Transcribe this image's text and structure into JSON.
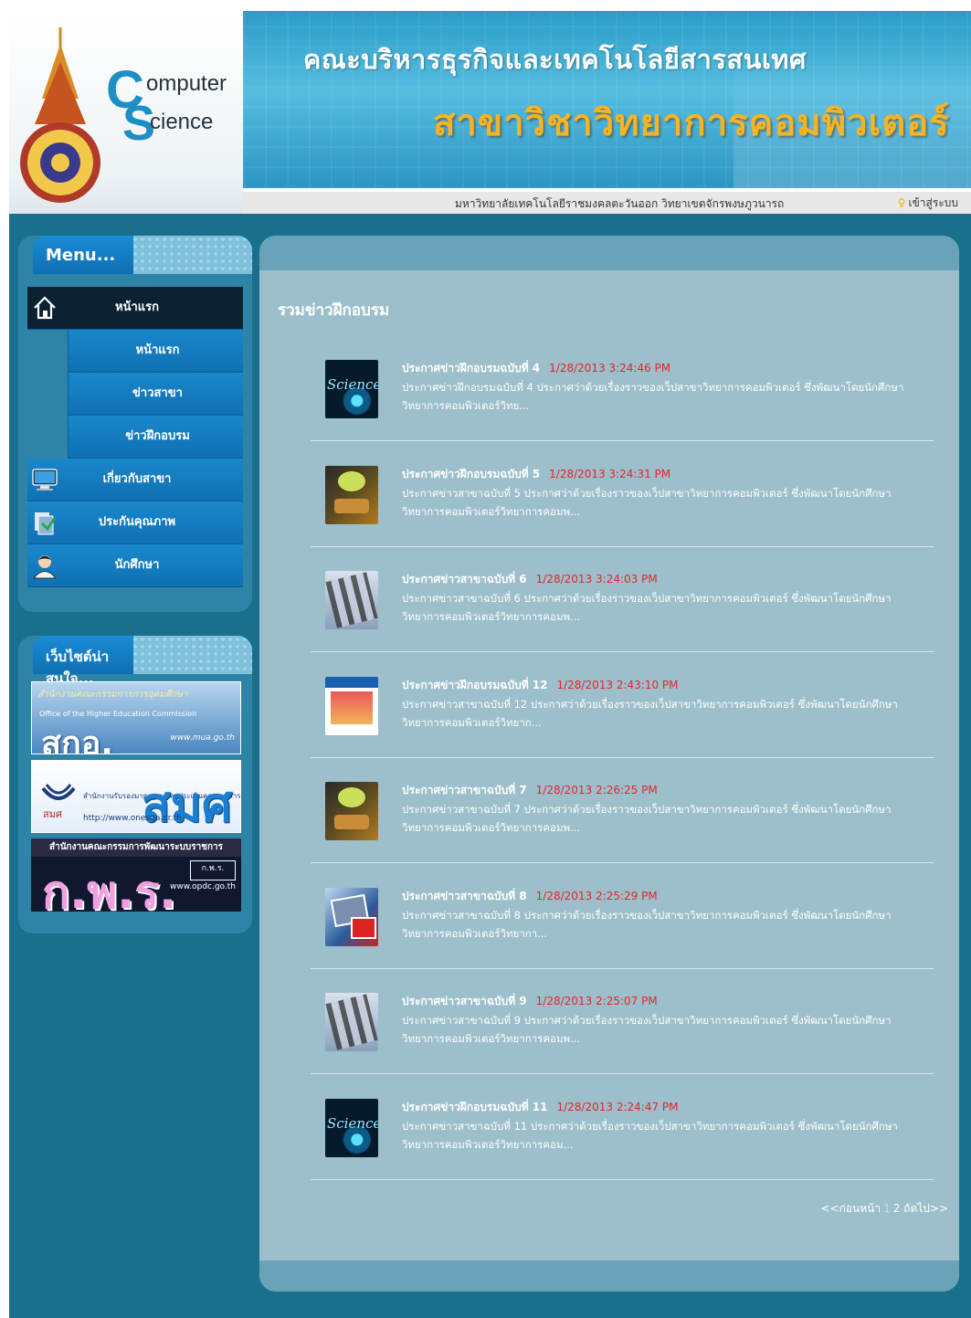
{
  "header": {
    "logo_line1": "omputer",
    "logo_line2": "cience",
    "logo_c": "C",
    "logo_s": "S",
    "banner_title": "คณะบริหารธุรกิจและเทคโนโลยีสารสนเทศ",
    "banner_subtitle": "สาขาวิชาวิทยาการคอมพิวเตอร์",
    "university": "มหาวิทยาลัยเทคโนโลยีราชมงคลตะวันออก วิทยาเขตจักรพงษภูวนารถ",
    "login_label": "เข้าสู่ระบบ"
  },
  "menu": {
    "title": "Menu...",
    "items": [
      {
        "label": "หน้าแรก",
        "icon": "home-icon",
        "active": true
      },
      {
        "label": "หน้าแรก",
        "sub": true
      },
      {
        "label": "ข่าวสาขา",
        "sub": true
      },
      {
        "label": "ข่าวฝึกอบรม",
        "sub": true
      },
      {
        "label": "เกี่ยวกับสาขา",
        "icon": "monitor-icon"
      },
      {
        "label": "ประกันคุณภาพ",
        "icon": "document-icon"
      },
      {
        "label": "นักศึกษา",
        "icon": "student-icon"
      }
    ]
  },
  "links": {
    "title": "เว็บไซต์น่าสนใจ...",
    "ohec": {
      "title": "สำนักงานคณะกรรมการการอุดมศึกษา",
      "subtitle": "Office of the Higher Education Commission",
      "big": "สกอ.",
      "url": "www.mua.go.th"
    },
    "onesqa": {
      "subtitle": "สำนักงานรับรองมาตรฐานและประเมินคุณภาพการศึกษา",
      "big": "สมศ",
      "url": "http://www.onesqa.or.th"
    },
    "opdc": {
      "title": "สำนักงานคณะกรรมการพัฒนาระบบราชการ",
      "big": "ก.พ.ร.",
      "badge": "ก.พ.ร.",
      "url": "www.opdc.go.th"
    }
  },
  "content": {
    "section_title": "รวมข่าวฝึกอบรม",
    "news": [
      {
        "title": "ประกาศข่าวฝึกอบรมฉบับที่ 4",
        "date": "1/28/2013 3:24:46 PM",
        "desc": "ประกาศข่าวฝึกอบรมฉบับที่ 4 ประกาศว่าด้วยเรื่องราวของเว็ปสาขาวิทยาการคอมพิวเตอร์ ซึ่งพัฒนาโดยนักศึกษาวิทยาการคอมพิวเตอร์วิทย...",
        "thumb": "science"
      },
      {
        "title": "ประกาศข่าวฝึกอบรมฉบับที่ 5",
        "date": "1/28/2013 3:24:31 PM",
        "desc": "ประกาศข่าวสาขาฉบับที่ 5 ประกาศว่าด้วยเรื่องราวของเว็ปสาขาวิทยาการคอมพิวเตอร์ ซึ่งพัฒนาโดยนักศึกษาวิทยาการคอมพิวเตอร์วิทยาการคอมพ...",
        "thumb": "disc"
      },
      {
        "title": "ประกาศข่าวสาขาฉบับที่ 6",
        "date": "1/28/2013 3:24:03 PM",
        "desc": "ประกาศข่าวสาขาฉบับที่ 6 ประกาศว่าด้วยเรื่องราวของเว็ปสาขาวิทยาการคอมพิวเตอร์ ซึ่งพัฒนาโดยนักศึกษาวิทยาการคอมพิวเตอร์วิทยาการคอมพ...",
        "thumb": "film"
      },
      {
        "title": "ประกาศข่าวฝึกอบรมฉบับที่ 12",
        "date": "1/28/2013 2:43:10 PM",
        "desc": "ประกาศข่าวสาขาฉบับที่ 12 ประกาศว่าด้วยเรื่องราวของเว็ปสาขาวิทยาการคอมพิวเตอร์ ซึ่งพัฒนาโดยนักศึกษาวิทยาการคอมพิวเตอร์วิทยาก...",
        "thumb": "book"
      },
      {
        "title": "ประกาศข่าวสาขาฉบับที่ 7",
        "date": "1/28/2013 2:26:25 PM",
        "desc": "ประกาศข่าวสาขาฉบับที่ 7 ประกาศว่าด้วยเรื่องราวของเว็ปสาขาวิทยาการคอมพิวเตอร์ ซึ่งพัฒนาโดยนักศึกษาวิทยาการคอมพิวเตอร์วิทยาการคอมพ...",
        "thumb": "disc"
      },
      {
        "title": "ประกาศข่าวสาขาฉบับที่ 8",
        "date": "1/28/2013 2:25:29 PM",
        "desc": "ประกาศข่าวสาขาฉบับที่ 8 ประกาศว่าด้วยเรื่องราวของเว็ปสาขาวิทยาการคอมพิวเตอร์ ซึ่งพัฒนาโดยนักศึกษาวิทยาการคอมพิวเตอร์วิทยากา...",
        "thumb": "travel"
      },
      {
        "title": "ประกาศข่าวสาขาฉบับที่ 9",
        "date": "1/28/2013 2:25:07 PM",
        "desc": "ประกาศข่าวสาขาฉบับที่ 9 ประกาศว่าด้วยเรื่องราวของเว็ปสาขาวิทยาการคอมพิวเตอร์ ซึ่งพัฒนาโดยนักศึกษาวิทยาการคอมพิวเตอร์วิทยาการคอมพ...",
        "thumb": "film"
      },
      {
        "title": "ประกาศข่าวฝึกอบรมฉบับที่ 11",
        "date": "1/28/2013 2:24:47 PM",
        "desc": "ประกาศข่าวสาขาฉบับที่ 11 ประกาศว่าด้วยเรื่องราวของเว็ปสาขาวิทยาการคอมพิวเตอร์ ซึ่งพัฒนาโดยนักศึกษาวิทยาการคอมพิวเตอร์วิทยาการคอม...",
        "thumb": "science"
      }
    ],
    "pagination": {
      "prev": "<<ก่อนหน้า",
      "current": "1",
      "page2": "2",
      "next": "ถัดไป>>"
    }
  },
  "colors": {
    "frame": "#1a6f8c",
    "content_bg": "#9cbfcb",
    "date_red": "#e8242c",
    "menu_blue": "#0f70b2",
    "banner_gold": "#f6b323"
  }
}
